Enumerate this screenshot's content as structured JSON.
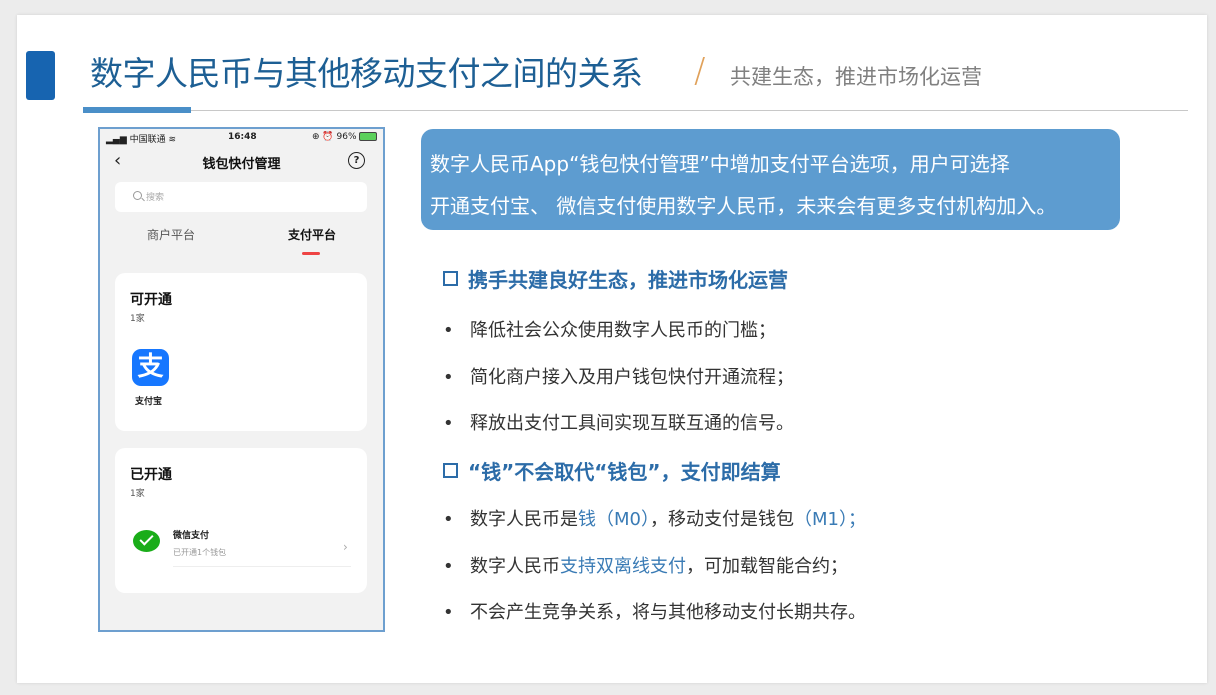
{
  "header": {
    "title": "数字人民币与其他移动支付之间的关系",
    "slash": "/",
    "subtitle": "共建生态，推进市场化运营"
  },
  "phone": {
    "status": {
      "carrier": "中国联通",
      "time": "16:48",
      "battery": "96%"
    },
    "nav_title": "钱包快付管理",
    "search_placeholder": "搜索",
    "tabs": [
      {
        "label": "商户平台"
      },
      {
        "label": "支付平台"
      }
    ],
    "available": {
      "title": "可开通",
      "count": "1家",
      "items": [
        {
          "name": "支付宝"
        }
      ]
    },
    "opened": {
      "title": "已开通",
      "count": "1家",
      "items": [
        {
          "name": "微信支付",
          "sub": "已开通1个钱包"
        }
      ]
    }
  },
  "callout": {
    "line1": "数字人民币App“钱包快付管理”中增加支付平台选项，用户可选择",
    "line2": "开通支付宝、 微信支付使用数字人民币，未来会有更多支付机构加入。"
  },
  "sections": [
    {
      "heading": "携手共建良好生态，推进市场化运营",
      "bullets": [
        {
          "text": "降低社会公众使用数字人民币的门槛；"
        },
        {
          "text": "简化商户接入及用户钱包快付开通流程；"
        },
        {
          "text": "释放出支付工具间实现互联互通的信号。"
        }
      ]
    },
    {
      "heading": "“钱”不会取代“钱包”，支付即结算",
      "bullets": [
        {
          "pre": "数字人民币是",
          "hl1": "钱（M0）",
          "mid": "，移动支付是钱包",
          "hl2": "（M1）；"
        },
        {
          "pre": "数字人民币",
          "hl1": "支持双离线支付",
          "mid": "，可加载智能合约；"
        },
        {
          "text": "不会产生竞争关系，将与其他移动支付长期共存。"
        }
      ]
    }
  ],
  "bullet_glyph": "•",
  "colors": {
    "title": "#1d5f94",
    "accent": "#1764b0",
    "callout_bg": "#5d9cd0",
    "highlight": "#3a7bb5"
  }
}
